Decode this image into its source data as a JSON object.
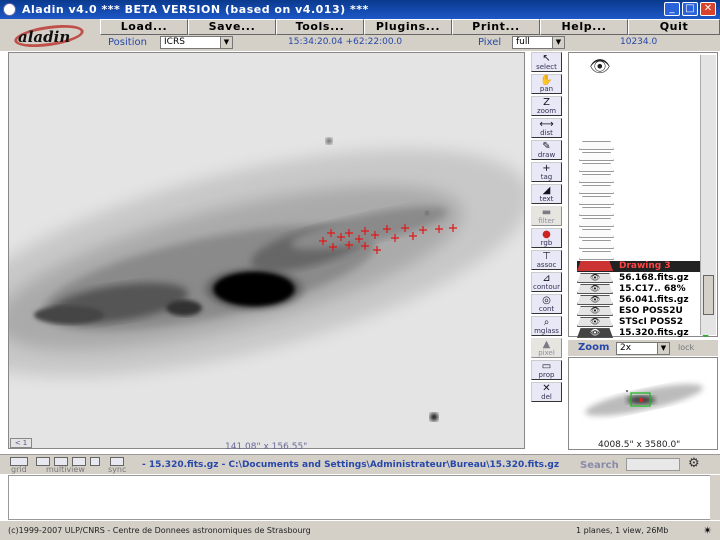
{
  "window": {
    "title": "Aladin v4.0   *** BETA VERSION (based on v4.013) ***",
    "min": "_",
    "max": "□",
    "close": "✕"
  },
  "logo": {
    "text": "aladin"
  },
  "menu": [
    "Load...",
    "Save...",
    "Tools...",
    "Plugins...",
    "Print...",
    "Help...",
    "Quit"
  ],
  "posbar": {
    "position_label": "Position",
    "frame_value": "ICRS",
    "coordinates": "15:34:20.04  +62:22:00.0",
    "pixel_label": "Pixel",
    "pixel_value": "full",
    "pixel_readout": "10234.0"
  },
  "view": {
    "coords": "141.08\" x 156.55\"",
    "corner": "< 1"
  },
  "tools": [
    {
      "icon": "select-icon",
      "glyph": "↖",
      "label": "select",
      "enabled": true
    },
    {
      "icon": "pan-icon",
      "glyph": "✋",
      "label": "pan",
      "enabled": true
    },
    {
      "icon": "zoom-icon",
      "glyph": "Z",
      "label": "zoom",
      "enabled": true
    },
    {
      "icon": "dist-icon",
      "glyph": "⟷",
      "label": "dist",
      "enabled": true
    },
    {
      "icon": "draw-icon",
      "glyph": "✎",
      "label": "draw",
      "enabled": true
    },
    {
      "icon": "tag-icon",
      "glyph": "+",
      "label": "tag",
      "enabled": true
    },
    {
      "icon": "text-icon",
      "glyph": "◢",
      "label": "text",
      "enabled": true
    },
    {
      "icon": "filter-icon",
      "glyph": "▬",
      "label": "filter",
      "enabled": false
    },
    {
      "icon": "rgb-icon",
      "glyph": "●",
      "label": "rgb",
      "enabled": true
    },
    {
      "icon": "assoc-icon",
      "glyph": "⊤",
      "label": "assoc",
      "enabled": true
    },
    {
      "icon": "contour-icon",
      "glyph": "⊿",
      "label": "contour",
      "enabled": true
    },
    {
      "icon": "cont-icon",
      "glyph": "◎",
      "label": "cont",
      "enabled": true
    },
    {
      "icon": "mglass-icon",
      "glyph": "⌕",
      "label": "mglass",
      "enabled": true
    },
    {
      "icon": "pixel-icon",
      "glyph": "▲",
      "label": "pixel",
      "enabled": false
    },
    {
      "icon": "prop-icon",
      "glyph": "▭",
      "label": "prop",
      "enabled": true
    },
    {
      "icon": "del-icon",
      "glyph": "✕",
      "label": "del",
      "enabled": true
    }
  ],
  "stack": {
    "layers": [
      {
        "name": "Drawing 3",
        "color": "#ff4444"
      },
      {
        "name": "56.168.fits.gz",
        "color": "#000000"
      },
      {
        "name": "15.C17.. 68%",
        "color": "#000000"
      },
      {
        "name": "56.041.fits.gz",
        "color": "#000000"
      },
      {
        "name": "ESO POSS2U",
        "color": "#000000"
      },
      {
        "name": "STScI POSS2",
        "color": "#000000"
      },
      {
        "name": "15.320.fits.gz",
        "color": "#000000"
      }
    ]
  },
  "zoom": {
    "label": "Zoom",
    "value": "2x",
    "lock": "lock",
    "coords": "4008.5\" x 3580.0\""
  },
  "bottom": {
    "grid_label": "grid",
    "multiview_label": "multiview",
    "sync_label": "sync",
    "path": "- 15.320.fits.gz - C:\\Documents and Settings\\Administrateur\\Bureau\\15.320.fits.gz",
    "search_label": "Search",
    "search_placeholder": ""
  },
  "status": {
    "copyright": "(c)1999-2007 ULP/CNRS - Centre de Donnees astronomiques de Strasbourg",
    "planes": "1 planes, 1 view, 26Mb"
  }
}
